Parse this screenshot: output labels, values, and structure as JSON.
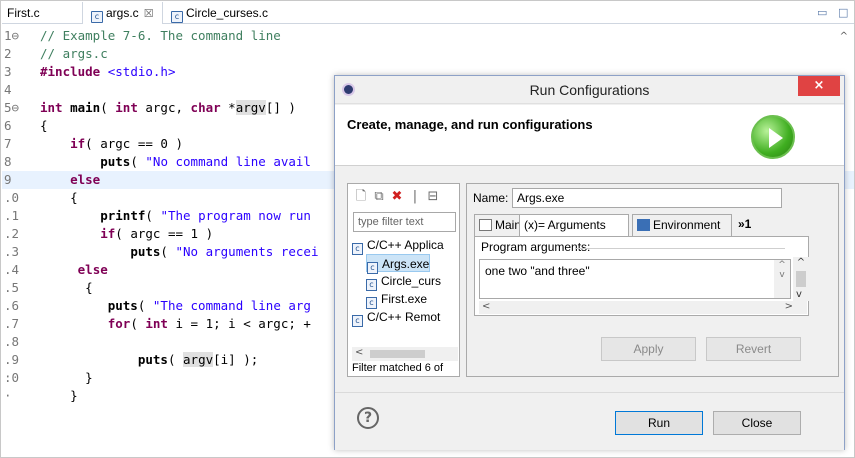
{
  "editor": {
    "tabs": [
      {
        "label": "First.c",
        "active": false
      },
      {
        "label": "args.c",
        "active": true,
        "close": "☒"
      },
      {
        "label": "Circle_curses.c",
        "active": false
      }
    ],
    "lines": [
      {
        "num": "1⊖",
        "parts": [
          [
            "cm",
            "// Example 7-6. The command line"
          ]
        ]
      },
      {
        "num": "2",
        "parts": [
          [
            "cm",
            "// args.c"
          ]
        ]
      },
      {
        "num": "3",
        "parts": [
          [
            "inc",
            "#include"
          ],
          [
            "",
            " "
          ],
          [
            "st",
            "<stdio.h>"
          ]
        ]
      },
      {
        "num": "4",
        "parts": []
      },
      {
        "num": "5⊖",
        "parts": [
          [
            "kw",
            "int"
          ],
          [
            "",
            " "
          ],
          [
            "fn",
            "main"
          ],
          [
            "",
            "( "
          ],
          [
            "kw",
            "int"
          ],
          [
            "",
            " argc, "
          ],
          [
            "kw",
            "char"
          ],
          [
            "",
            " *"
          ],
          [
            "mark",
            "argv"
          ],
          [
            "",
            "[] )"
          ]
        ]
      },
      {
        "num": "6",
        "parts": [
          [
            "",
            "{"
          ]
        ]
      },
      {
        "num": "7",
        "parts": [
          [
            "",
            "    "
          ],
          [
            "kw",
            "if"
          ],
          [
            "",
            "( argc == 0 )"
          ]
        ]
      },
      {
        "num": "8",
        "parts": [
          [
            "",
            "        "
          ],
          [
            "fn",
            "puts"
          ],
          [
            "",
            "( "
          ],
          [
            "st",
            "\"No command line avail"
          ]
        ]
      },
      {
        "num": "9",
        "hl": true,
        "parts": [
          [
            "",
            "    "
          ],
          [
            "kw",
            "else"
          ]
        ]
      },
      {
        "num": ".0",
        "parts": [
          [
            "",
            "    {"
          ]
        ]
      },
      {
        "num": ".1",
        "parts": [
          [
            "",
            "        "
          ],
          [
            "fn",
            "printf"
          ],
          [
            "",
            "( "
          ],
          [
            "st",
            "\"The program now run"
          ]
        ]
      },
      {
        "num": ".2",
        "parts": [
          [
            "",
            "        "
          ],
          [
            "kw",
            "if"
          ],
          [
            "",
            "( argc == 1 )"
          ]
        ]
      },
      {
        "num": ".3",
        "parts": [
          [
            "",
            "            "
          ],
          [
            "fn",
            "puts"
          ],
          [
            "",
            "( "
          ],
          [
            "st",
            "\"No arguments recei"
          ]
        ]
      },
      {
        "num": ".4",
        "parts": [
          [
            "",
            "     "
          ],
          [
            "kw",
            "else"
          ]
        ]
      },
      {
        "num": ".5",
        "parts": [
          [
            "",
            "      {"
          ]
        ]
      },
      {
        "num": ".6",
        "parts": [
          [
            "",
            "         "
          ],
          [
            "fn",
            "puts"
          ],
          [
            "",
            "( "
          ],
          [
            "st",
            "\"The command line arg"
          ]
        ]
      },
      {
        "num": ".7",
        "parts": [
          [
            "",
            "         "
          ],
          [
            "kw",
            "for"
          ],
          [
            "",
            "( "
          ],
          [
            "kw",
            "int"
          ],
          [
            "",
            " i = 1; i < argc; +"
          ]
        ]
      },
      {
        "num": ".8",
        "parts": []
      },
      {
        "num": ".9",
        "parts": [
          [
            "",
            "             "
          ],
          [
            "fn",
            "puts"
          ],
          [
            "",
            "( "
          ],
          [
            "mark",
            "argv"
          ],
          [
            "",
            "[i] );"
          ]
        ]
      },
      {
        "num": ":0",
        "parts": [
          [
            "",
            "      }"
          ]
        ]
      },
      {
        "num": "·",
        "parts": [
          [
            "",
            "    }"
          ]
        ]
      }
    ]
  },
  "dialog": {
    "title": "Run Configurations",
    "close_glyph": "×",
    "header_text": "Create, manage, and run configurations",
    "filter_placeholder": "type filter text",
    "tree": [
      {
        "label": "C/C++ Applica",
        "indent": 0,
        "selected": false
      },
      {
        "label": "Args.exe",
        "indent": 1,
        "selected": true
      },
      {
        "label": "Circle_curs",
        "indent": 1,
        "selected": false
      },
      {
        "label": "First.exe",
        "indent": 1,
        "selected": false
      },
      {
        "label": "C/C++ Remot",
        "indent": 0,
        "selected": false
      }
    ],
    "filter_status": "Filter matched 6 of",
    "name_label": "Name:",
    "name_value": "Args.exe",
    "tabs": [
      {
        "label": "Main",
        "active": false
      },
      {
        "label": "(x)= Arguments",
        "active": true
      },
      {
        "label": "Environment",
        "active": false
      },
      {
        "label": "»1",
        "active": false
      }
    ],
    "program_args_label": "Program arguments:",
    "program_args_value": "one two \"and three\"",
    "apply_label": "Apply",
    "revert_label": "Revert",
    "run_label": "Run",
    "close_label": "Close",
    "help_glyph": "?"
  }
}
